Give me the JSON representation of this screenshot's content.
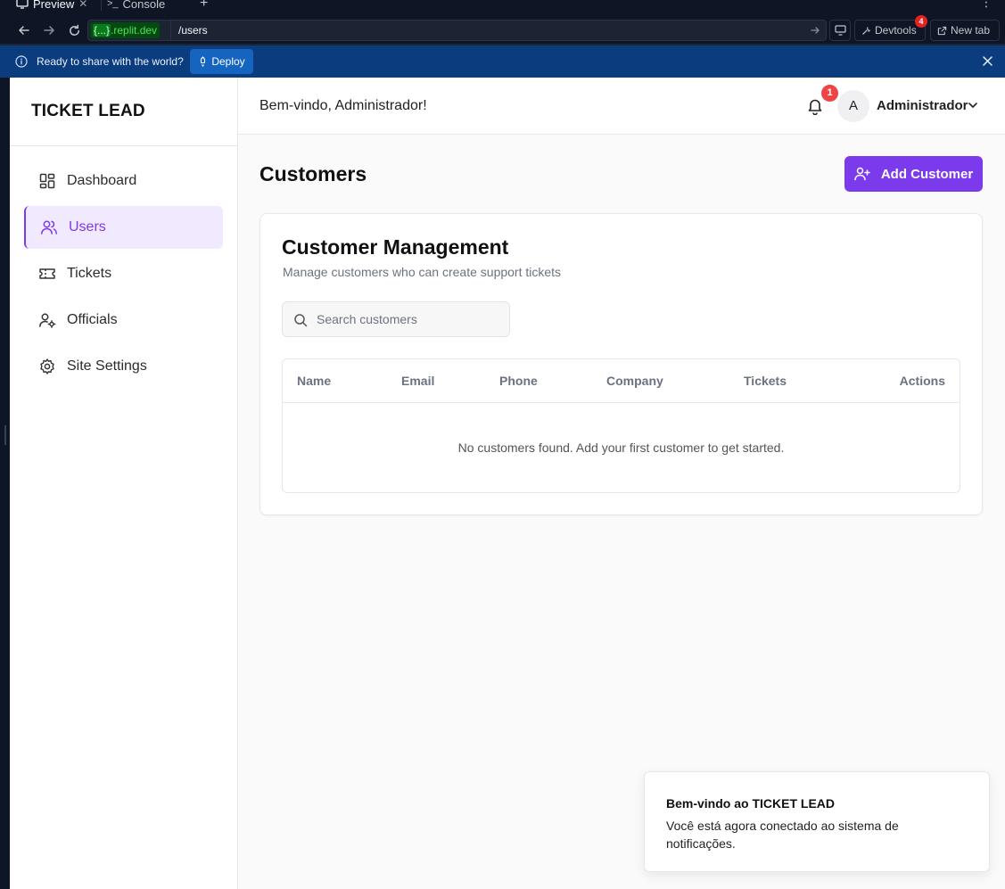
{
  "chrome": {
    "tabs": [
      {
        "label": "Preview",
        "active": true,
        "icon": "monitor-icon"
      },
      {
        "label": "Console",
        "active": false,
        "icon": "terminal-icon"
      }
    ],
    "url": {
      "domain_token": "{...}",
      "domain_suffix": ".replit.dev",
      "path": "/users"
    },
    "devtools_label": "Devtools",
    "devtools_badge": "4",
    "newtab_label": "New tab",
    "deploy": {
      "message": "Ready to share with the world?",
      "button": "Deploy"
    },
    "colors": {
      "chrome_bg": "#0e1525",
      "deploy_bar": "#0b3c7d",
      "domain_green": "#4ee05a"
    }
  },
  "app": {
    "brand": "TICKET LEAD",
    "welcome": "Bem-vindo, Administrador!",
    "notifications_count": "1",
    "user": {
      "initial": "A",
      "name": "Administrador"
    },
    "sidebar": {
      "items": [
        {
          "label": "Dashboard",
          "icon": "dashboard-icon",
          "active": false
        },
        {
          "label": "Users",
          "icon": "users-icon",
          "active": true
        },
        {
          "label": "Tickets",
          "icon": "ticket-icon",
          "active": false
        },
        {
          "label": "Officials",
          "icon": "user-cog-icon",
          "active": false
        },
        {
          "label": "Site Settings",
          "icon": "gear-icon",
          "active": false
        }
      ]
    },
    "page": {
      "title": "Customers",
      "add_button": "Add Customer",
      "card_title": "Customer Management",
      "card_subtitle": "Manage customers who can create support tickets",
      "search_placeholder": "Search customers",
      "table": {
        "columns": [
          "Name",
          "Email",
          "Phone",
          "Company",
          "Tickets",
          "Actions"
        ],
        "rows": [],
        "empty_message": "No customers found. Add your first customer to get started."
      }
    },
    "toast": {
      "title": "Bem-vindo ao TICKET LEAD",
      "body": "Você está agora conectado ao sistema de notificações."
    },
    "colors": {
      "accent": "#7c3aed",
      "accent_soft": "#f1e9fe",
      "badge_red": "#ef4444"
    }
  }
}
